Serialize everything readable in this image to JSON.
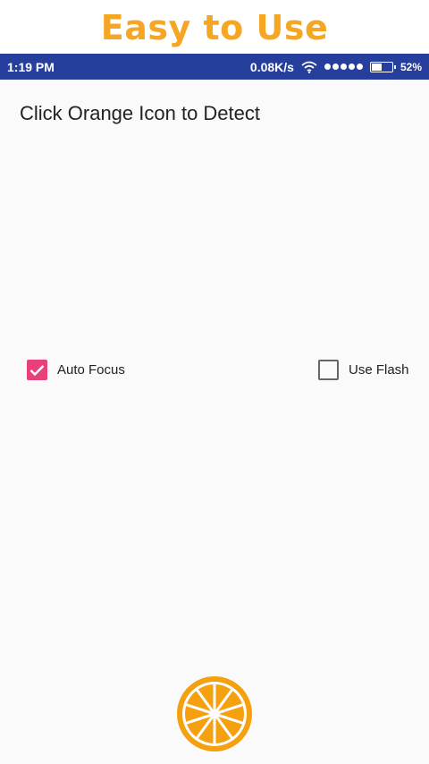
{
  "banner": {
    "title": "Easy to Use",
    "color": "#f5a623"
  },
  "status_bar": {
    "time": "1:19 PM",
    "network_speed": "0.08K/s",
    "wifi_icon": "wifi-icon",
    "signal_icon": "signal-dots-icon",
    "battery_icon": "battery-icon",
    "battery_level": 0.52,
    "battery_percent": "52%",
    "background": "#263f9c"
  },
  "main": {
    "instruction": "Click Orange Icon to Detect",
    "options": [
      {
        "label": "Auto Focus",
        "checked": true,
        "accent": "#e8407a"
      },
      {
        "label": "Use Flash",
        "checked": false
      }
    ],
    "detect_button": {
      "icon": "orange-slice-icon",
      "color": "#f5a00f"
    }
  }
}
